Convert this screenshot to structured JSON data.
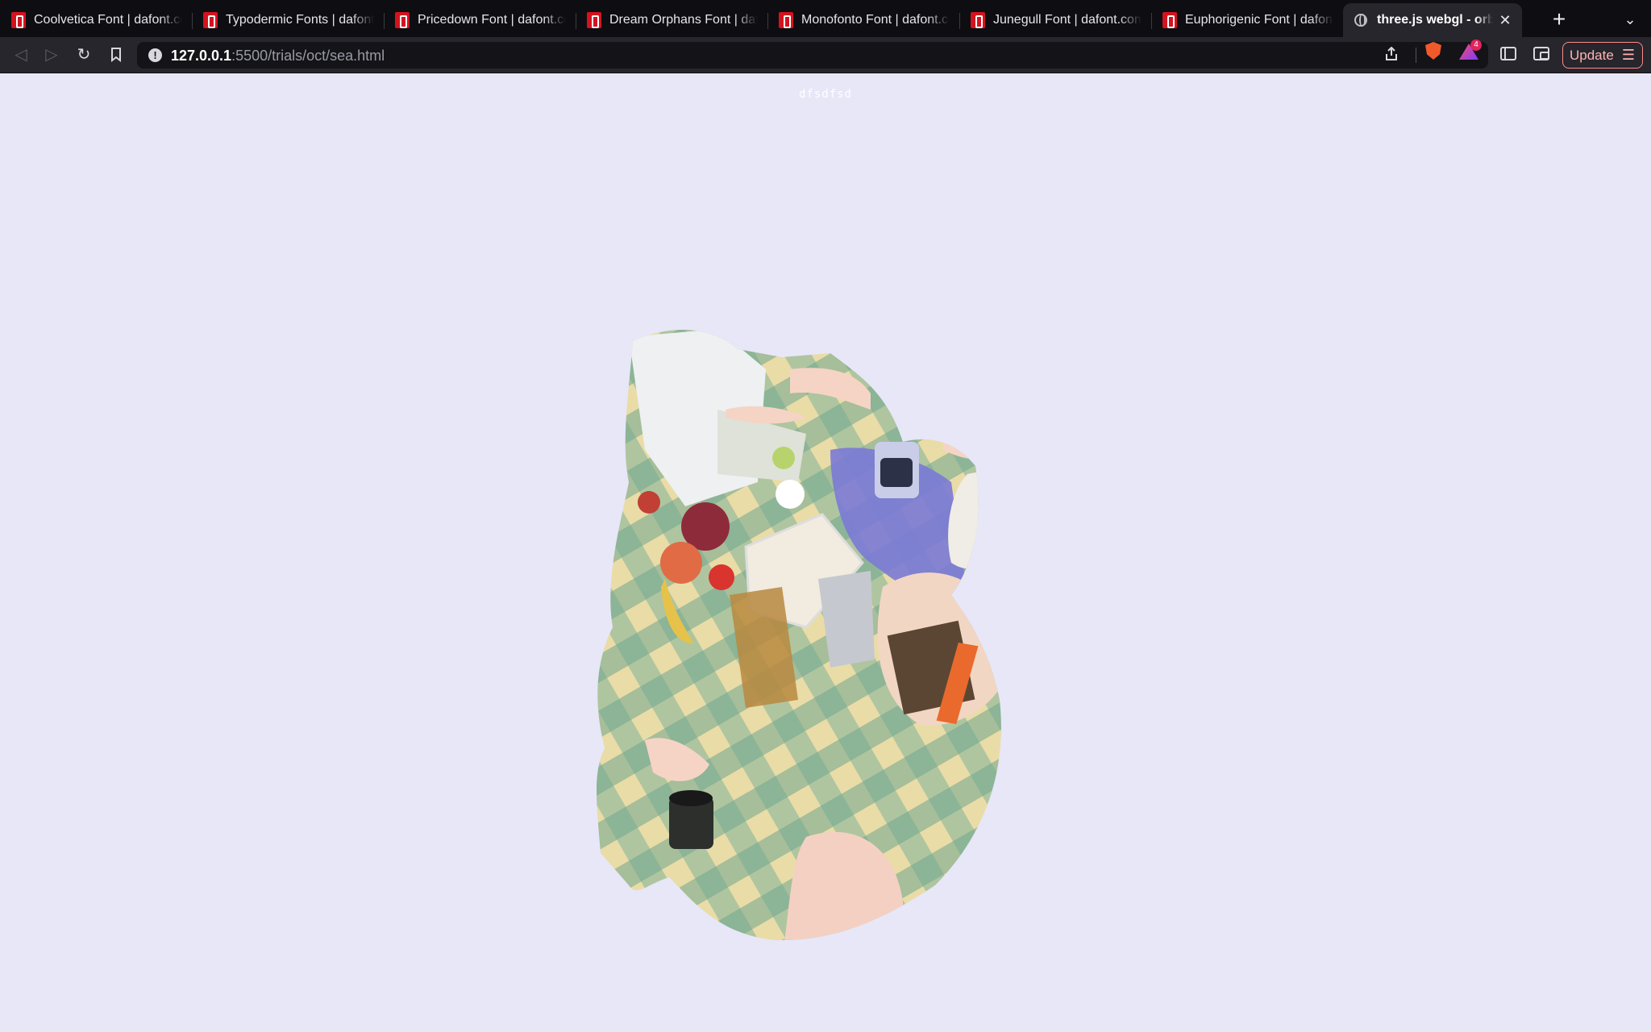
{
  "tabs": [
    {
      "title": "Coolvetica Font | dafont.com",
      "favicon": "dafont-icon"
    },
    {
      "title": "Typodermic Fonts | dafont.com",
      "favicon": "dafont-icon"
    },
    {
      "title": "Pricedown Font | dafont.com",
      "favicon": "dafont-icon"
    },
    {
      "title": "Dream Orphans Font | dafont.com",
      "favicon": "dafont-icon"
    },
    {
      "title": "Monofonto Font | dafont.com",
      "favicon": "dafont-icon"
    },
    {
      "title": "Junegull Font | dafont.com",
      "favicon": "dafont-icon"
    },
    {
      "title": "Euphorigenic Font | dafont.com",
      "favicon": "dafont-icon"
    },
    {
      "title": "three.js webgl - orbit controls",
      "favicon": "globe-icon",
      "active": true
    }
  ],
  "toolbar": {
    "url_host": "127.0.0.1",
    "url_rest": ":5500/trials/oct/sea.html",
    "rewards_count": "4",
    "update_label": "Update"
  },
  "page": {
    "heading": "dfsdfsd",
    "background": "#e7e7f8",
    "scene": "picnic-photo-cutout"
  },
  "colors": {
    "tab_strip": "#0e0e12",
    "toolbar": "#26262c",
    "url_field": "#131318",
    "update_border": "#ff8b8b",
    "favicon_red": "#d4131f"
  }
}
